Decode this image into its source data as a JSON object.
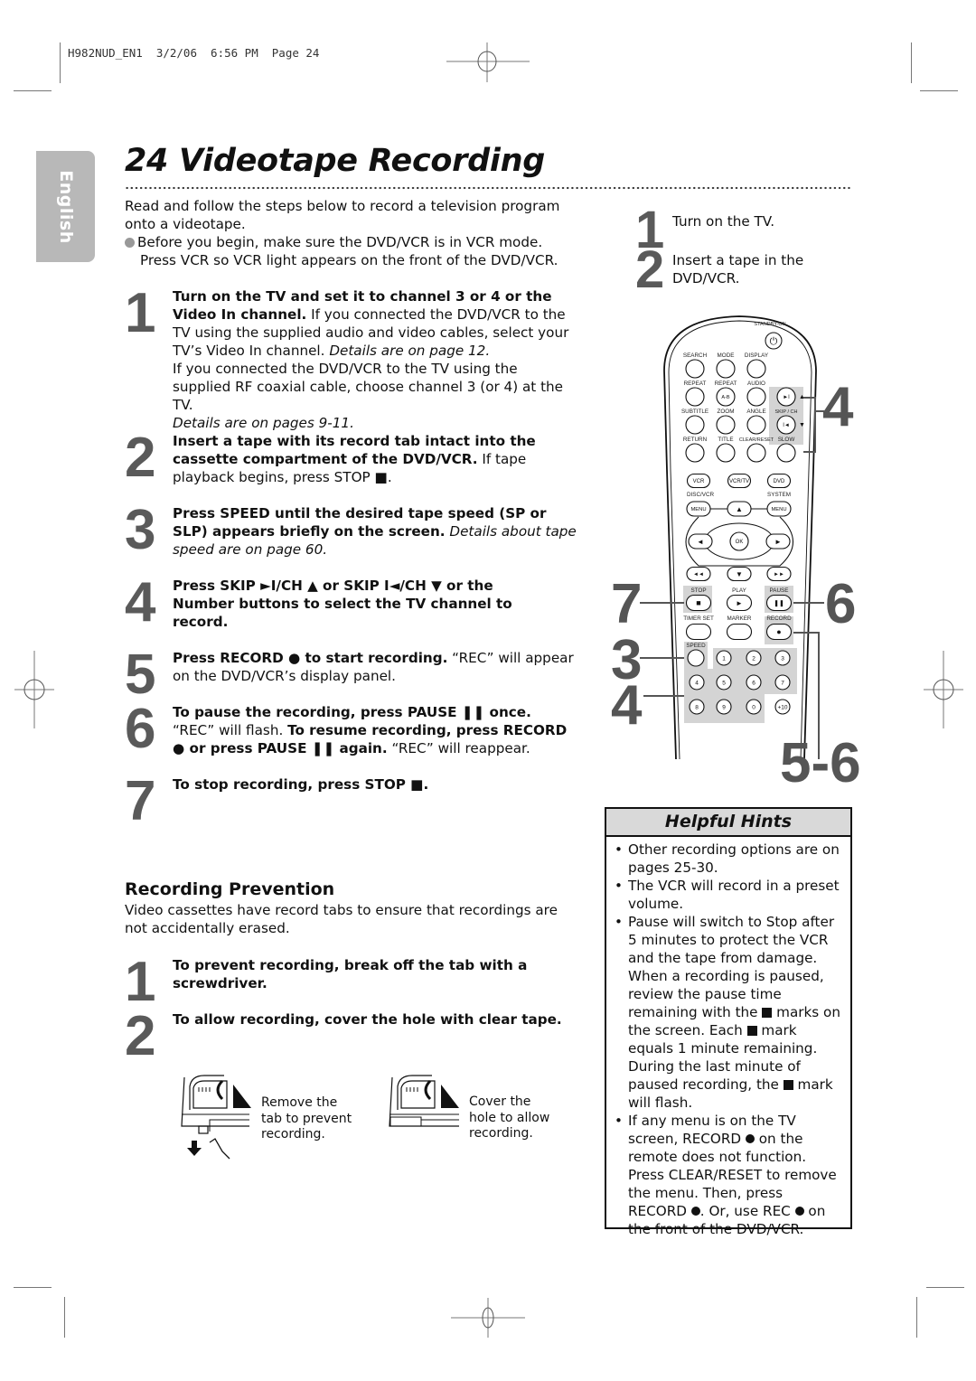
{
  "print_slug": "H982NUD_EN1  3/2/06  6:56 PM  Page 24",
  "language_tab": "English",
  "title": "24  Videotape Recording",
  "intro": {
    "text": "Read and follow the steps below to record a television program onto a videotape.",
    "bullet_line1": "Before you begin, make sure the DVD/VCR is in VCR mode.",
    "bullet_line2": "Press VCR so VCR light appears on the front of the DVD/VCR."
  },
  "steps": [
    {
      "num": "1",
      "bold": "Turn on the TV and set it to channel 3 or 4 or the Video In channel.",
      "text": " If you connected the DVD/VCR to the TV using the supplied audio and video cables, select your TV’s Video In channel. ",
      "italic": "Details are on page 12.",
      "text2": "If you connected the DVD/VCR to the TV using the supplied RF coaxial cable, choose channel 3 (or 4) at the TV.",
      "italic2": "Details are on pages 9-11."
    },
    {
      "num": "2",
      "bold": "Insert a tape with its record tab intact into the cassette compartment of the DVD/VCR.",
      "text": " If tape playback begins, press STOP ■."
    },
    {
      "num": "3",
      "bold": "Press SPEED until the desired tape speed (SP or SLP) appears briefly on the screen.",
      "italic": " Details about tape speed are on page 60."
    },
    {
      "num": "4",
      "bold": "Press SKIP ►I/CH ▲ or SKIP I◄/CH ▼ or the Number buttons to select the TV channel to record."
    },
    {
      "num": "5",
      "bold": "Press RECORD ● to start recording.",
      "text": " “REC” will appear on the DVD/VCR’s display panel."
    },
    {
      "num": "6",
      "bold": "To pause the recording, press PAUSE ❚❚ once.",
      "text": " “REC” will flash. ",
      "bold2": "To resume recording, press RECORD ● or press PAUSE ❚❚ again.",
      "text2": " “REC” will reappear."
    },
    {
      "num": "7",
      "bold": "To stop recording, press STOP ■."
    }
  ],
  "prevention": {
    "heading": "Recording Prevention",
    "body": "Video cassettes have record tabs to ensure that recordings are not accidentally erased.",
    "steps": [
      {
        "num": "1",
        "bold": "To prevent recording, break off the tab with a screwdriver."
      },
      {
        "num": "2",
        "bold": "To allow recording, cover the hole with clear tape."
      }
    ],
    "captions": [
      "Remove the tab to prevent recording.",
      "Cover the hole to allow recording."
    ]
  },
  "right_steps": [
    {
      "num": "1",
      "text": "Turn on the TV."
    },
    {
      "num": "2",
      "text": "Insert a tape in the DVD/VCR."
    }
  ],
  "remote": {
    "standby": "STANDBY-ON",
    "row1": [
      "SEARCH",
      "MODE",
      "DISPLAY"
    ],
    "row2": [
      "REPEAT",
      "REPEAT",
      "AUDIO"
    ],
    "ab": "A-B",
    "row3": [
      "SUBTITLE",
      "ZOOM",
      "ANGLE",
      "SKIP / CH"
    ],
    "row4": [
      "RETURN",
      "TITLE",
      "CLEAR/RESET",
      "SLOW"
    ],
    "modes": [
      "VCR",
      "VCR/TV",
      "DVD"
    ],
    "disc_vcr": "DISC/VCR",
    "system": "SYSTEM",
    "menu": "MENU",
    "ok": "OK",
    "transport": [
      "STOP",
      "PLAY",
      "PAUSE"
    ],
    "row_timer": [
      "TIMER SET",
      "MARKER",
      "RECORD"
    ],
    "speed": "SPEED",
    "numbers": [
      "1",
      "2",
      "3",
      "4",
      "5",
      "6",
      "7",
      "8",
      "9",
      "0",
      "+10"
    ]
  },
  "callouts": {
    "skip": "4",
    "stop": "7",
    "pause": "6",
    "speed": "3",
    "numbers": "4",
    "record": "5-6"
  },
  "hints": {
    "title": "Helpful Hints",
    "items": [
      "Other recording options are on pages 25-30.",
      "The VCR will record in a preset volume.",
      "Pause will switch to Stop after 5 minutes to protect the VCR and the tape from damage. When a recording is paused, review the pause time remaining with the ■ marks on the screen. Each ■ mark equals 1 minute remaining. During the last minute of paused recording, the ■ mark will flash.",
      "If any menu is on the TV screen, RECORD ● on the remote does not function. Press CLEAR/RESET to remove the menu. Then, press RECORD ●. Or, use REC ● on the front of the DVD/VCR."
    ]
  },
  "colors": {
    "step_number": "#5a5a5a",
    "tab_gray": "#b8b8b8",
    "hint_header": "#d9d9d9",
    "highlight": "#d4d4d4"
  }
}
